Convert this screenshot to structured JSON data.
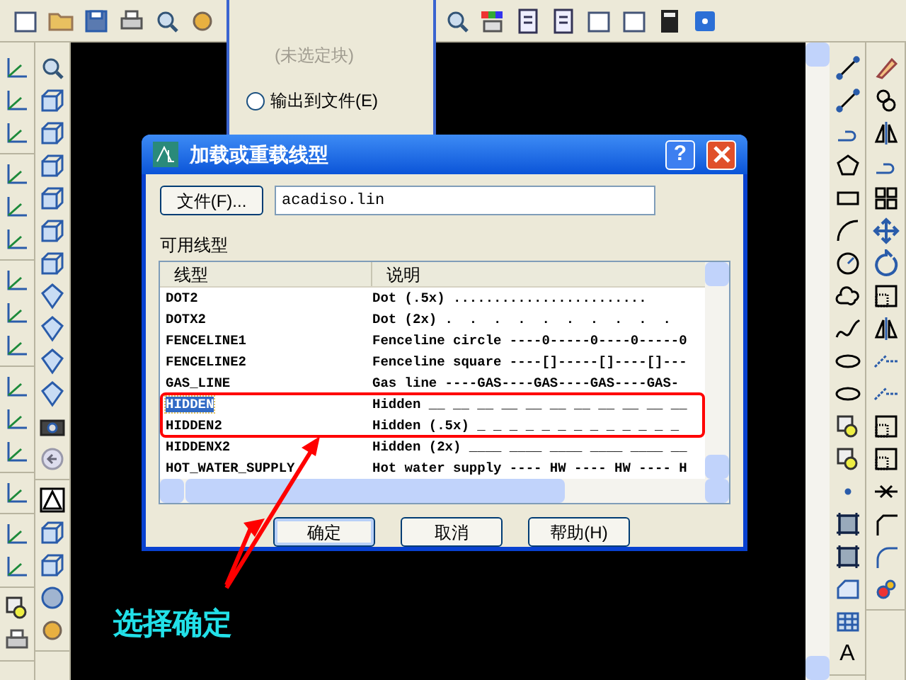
{
  "background_dialog": {
    "status": "(未选定块)",
    "radio": {
      "label": "输出到文件(E)",
      "selected": false
    }
  },
  "dialog": {
    "title": "加载或重载线型",
    "help_button": "?",
    "file_button": "文件(F)...",
    "file_name": "acadiso.lin",
    "list_label": "可用线型",
    "columns": [
      "线型",
      "说明"
    ],
    "rows": [
      {
        "name": "DOT2",
        "description": "Dot (.5x) ........................",
        "selected": false
      },
      {
        "name": "DOTX2",
        "description": "Dot (2x) .  .  .  .  .  .  .  .  .  .",
        "selected": false
      },
      {
        "name": "FENCELINE1",
        "description": "Fenceline circle ----0-----0----0-----0",
        "selected": false
      },
      {
        "name": "FENCELINE2",
        "description": "Fenceline square ----[]-----[]----[]---",
        "selected": false
      },
      {
        "name": "GAS_LINE",
        "description": "Gas line ----GAS----GAS----GAS----GAS-",
        "selected": false
      },
      {
        "name": "HIDDEN",
        "description": "Hidden __ __ __ __ __ __ __ __ __ __ __",
        "selected": true
      },
      {
        "name": "HIDDEN2",
        "description": "Hidden (.5x) _ _ _ _ _ _ _ _ _ _ _ _ _",
        "selected": false
      },
      {
        "name": "HIDDENX2",
        "description": "Hidden (2x) ____ ____ ____ ____ ____ __",
        "selected": false
      },
      {
        "name": "HOT_WATER_SUPPLY",
        "description": "Hot water supply ---- HW ---- HW ---- H",
        "selected": false
      }
    ],
    "buttons": [
      "确定",
      "取消",
      "帮助(H)"
    ]
  },
  "text_tool": "A",
  "annotation": {
    "caption": "选择确定"
  }
}
